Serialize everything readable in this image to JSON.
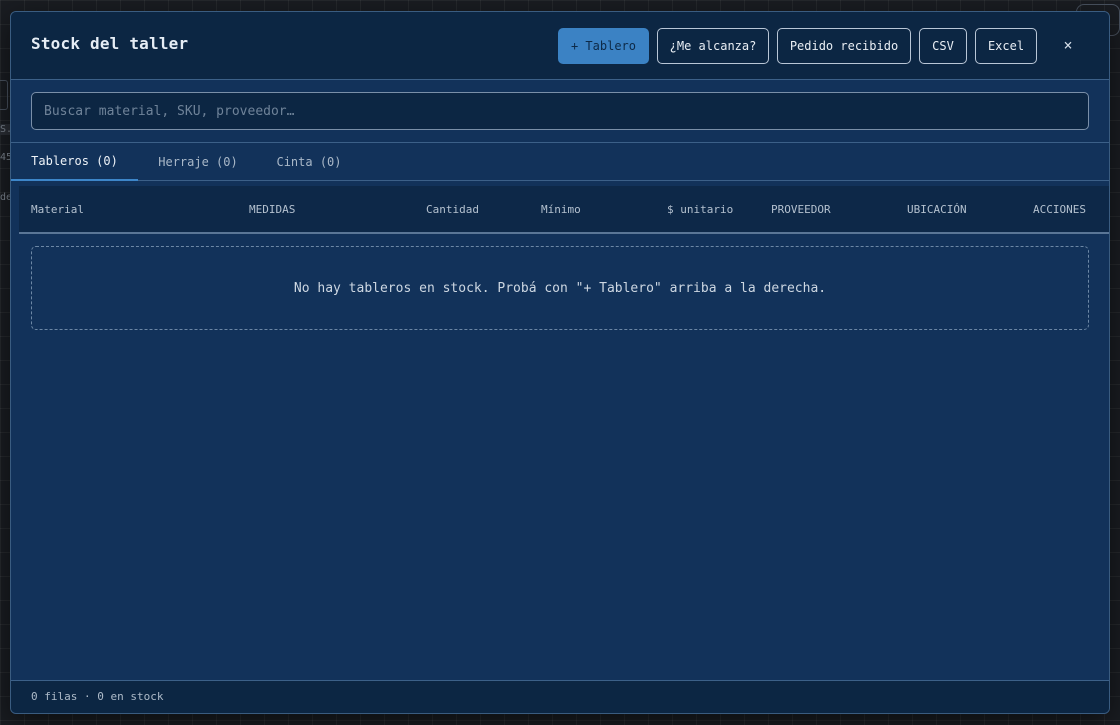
{
  "modal": {
    "title": "Stock del taller",
    "close_label": "×"
  },
  "toolbar": {
    "add_board_label": "+ Tablero",
    "check_fit_label": "¿Me alcanza?",
    "order_received_label": "Pedido recibido",
    "csv_label": "CSV",
    "excel_label": "Excel"
  },
  "search": {
    "placeholder": "Buscar material, SKU, proveedor…",
    "value": ""
  },
  "tabs": [
    {
      "label": "Tableros (0)",
      "active": true
    },
    {
      "label": "Herraje (0)",
      "active": false
    },
    {
      "label": "Cinta (0)",
      "active": false
    }
  ],
  "table": {
    "columns": [
      "Material",
      "MEDIDAS",
      "Cantidad",
      "Mínimo",
      "$ unitario",
      "PROVEEDOR",
      "UBICACIÓN",
      "ACCIONES"
    ],
    "rows": [],
    "empty_message": "No hay tableros en stock. Probá con \"+ Tablero\" arriba a la derecha."
  },
  "footer": {
    "summary": "0 filas · 0 en stock"
  },
  "background": {
    "fragments": [
      "S.",
      "45",
      "de"
    ]
  },
  "colors": {
    "accent": "#3b82c4",
    "modal_bg": "#12325a",
    "header_bg": "#0c2643"
  }
}
